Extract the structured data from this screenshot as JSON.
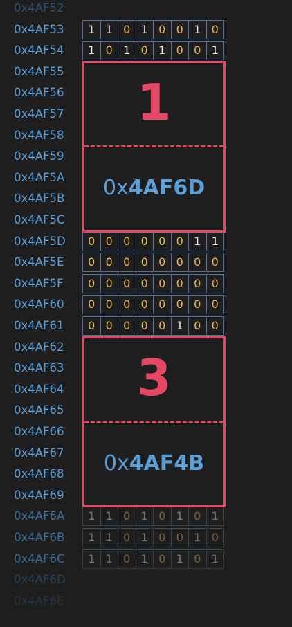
{
  "rows": [
    {
      "address": "0x4AF52",
      "bits": null,
      "style": "ghost"
    },
    {
      "address": "0x4AF53",
      "bits": "11010010",
      "style": "normal"
    },
    {
      "address": "0x4AF54",
      "bits": "10101001",
      "style": "normal"
    },
    {
      "address": "0x4AF55",
      "bits": null,
      "style": "normal"
    },
    {
      "address": "0x4AF56",
      "bits": null,
      "style": "normal"
    },
    {
      "address": "0x4AF57",
      "bits": null,
      "style": "normal"
    },
    {
      "address": "0x4AF58",
      "bits": null,
      "style": "normal"
    },
    {
      "address": "0x4AF59",
      "bits": null,
      "style": "normal"
    },
    {
      "address": "0x4AF5A",
      "bits": null,
      "style": "normal"
    },
    {
      "address": "0x4AF5B",
      "bits": null,
      "style": "normal"
    },
    {
      "address": "0x4AF5C",
      "bits": null,
      "style": "normal"
    },
    {
      "address": "0x4AF5D",
      "bits": "00000011",
      "style": "normal"
    },
    {
      "address": "0x4AF5E",
      "bits": "00000000",
      "style": "normal"
    },
    {
      "address": "0x4AF5F",
      "bits": "00000000",
      "style": "normal"
    },
    {
      "address": "0x4AF60",
      "bits": "00000000",
      "style": "normal"
    },
    {
      "address": "0x4AF61",
      "bits": "00000100",
      "style": "normal"
    },
    {
      "address": "0x4AF62",
      "bits": null,
      "style": "normal"
    },
    {
      "address": "0x4AF63",
      "bits": null,
      "style": "normal"
    },
    {
      "address": "0x4AF64",
      "bits": null,
      "style": "normal"
    },
    {
      "address": "0x4AF65",
      "bits": null,
      "style": "normal"
    },
    {
      "address": "0x4AF66",
      "bits": null,
      "style": "normal"
    },
    {
      "address": "0x4AF67",
      "bits": null,
      "style": "normal"
    },
    {
      "address": "0x4AF68",
      "bits": null,
      "style": "normal"
    },
    {
      "address": "0x4AF69",
      "bits": null,
      "style": "normal"
    },
    {
      "address": "0x4AF6A",
      "bits": "11010101",
      "style": "faded"
    },
    {
      "address": "0x4AF6B",
      "bits": "11010010",
      "style": "faded"
    },
    {
      "address": "0x4AF6C",
      "bits": "11010101",
      "style": "faded"
    },
    {
      "address": "0x4AF6D",
      "bits": null,
      "style": "ghost"
    },
    {
      "address": "0x4AF6E",
      "bits": null,
      "style": "ghost"
    }
  ],
  "blocks": [
    {
      "number": "1",
      "pointer_prefix": "0x",
      "pointer_hex": "4AF6D"
    },
    {
      "number": "3",
      "pointer_prefix": "0x",
      "pointer_hex": "4AF4B"
    }
  ],
  "colors": {
    "background": "#1e1e1f",
    "address": "#5c9fd6",
    "bit_one": "#e9e9e9",
    "bit_zero": "#e9b95a",
    "cell_border": "#4e6e98",
    "highlight": "#e54865"
  }
}
